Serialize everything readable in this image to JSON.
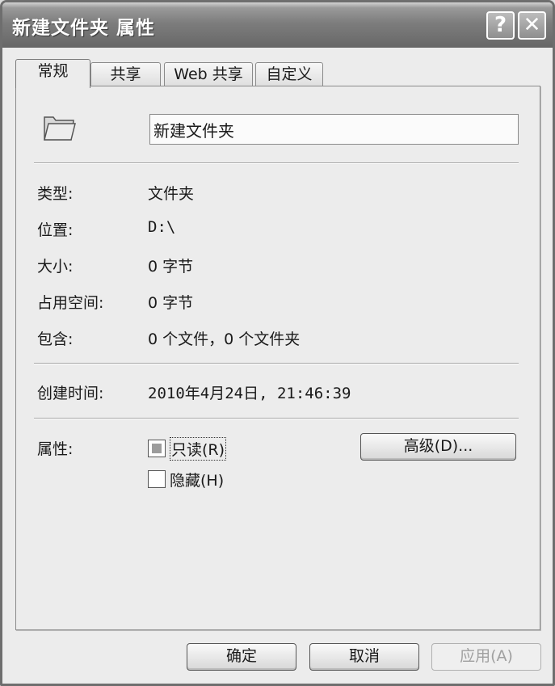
{
  "window": {
    "title": "新建文件夹 属性",
    "help_glyph": "?",
    "close_glyph": "✕"
  },
  "tabs": [
    {
      "label": "常规",
      "active": true
    },
    {
      "label": "共享",
      "active": false
    },
    {
      "label": "Web 共享",
      "active": false
    },
    {
      "label": "自定义",
      "active": false
    }
  ],
  "general": {
    "folder_name": "新建文件夹",
    "rows": [
      {
        "label": "类型:",
        "value": "文件夹"
      },
      {
        "label": "位置:",
        "value": "D:\\"
      },
      {
        "label": "大小:",
        "value": "0 字节"
      },
      {
        "label": "占用空间:",
        "value": "0 字节"
      },
      {
        "label": "包含:",
        "value": "0 个文件，0 个文件夹"
      }
    ],
    "created_label": "创建时间:",
    "created_value": "2010年4月24日, 21:46:39",
    "attributes_label": "属性:",
    "readonly_label": "只读(R)",
    "readonly_state": "indeterminate",
    "hidden_label": "隐藏(H)",
    "hidden_state": "unchecked",
    "advanced_label": "高级(D)..."
  },
  "footer": {
    "ok_label": "确定",
    "cancel_label": "取消",
    "apply_label": "应用(A)",
    "apply_enabled": false
  },
  "colors": {
    "titlebar": "#7d7d7d",
    "dialog_bg": "#ececec"
  }
}
